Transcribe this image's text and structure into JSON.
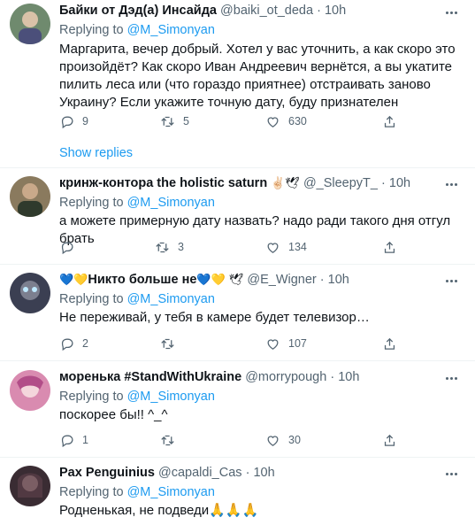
{
  "show_replies": "Show replies",
  "tweets": [
    {
      "name": "Байки от Дэд(а) Инсайда",
      "handle": "@baiki_ot_deda",
      "time": "10h",
      "replying_label": "Replying to",
      "replying_to": "@M_Simonyan",
      "text": "Маргарита, вечер добрый. Хотел у вас уточнить, а как скоро это произойдёт? Как скоро Иван Андреевич вернётся, а вы укатите пилить леса или (что гораздо приятнее) отстраивать заново Украину? Если укажите точную дату, буду признателен",
      "replies": "9",
      "retweets": "5",
      "likes": "630"
    },
    {
      "name": "кринж-контора the holistic saturn",
      "emoji": "✌🏻🕊",
      "handle": "@_SleepyT_",
      "time": "10h",
      "replying_label": "Replying to",
      "replying_to": "@M_Simonyan",
      "text": "а можете примерную дату назвать? надо ради такого дня отгул брать",
      "replies": "",
      "retweets": "3",
      "likes": "134"
    },
    {
      "name_prefix": "💙💛",
      "name": "Никто больше не",
      "name_suffix": "💙💛",
      "emoji": "🕊",
      "handle": "@E_Wigner",
      "time": "10h",
      "replying_label": "Replying to",
      "replying_to": "@M_Simonyan",
      "text": "Не переживай, у тебя в камере будет телевизор…",
      "replies": "2",
      "retweets": "",
      "likes": "107"
    },
    {
      "name": "моренька #StandWithUkraine",
      "handle": "@morrypough",
      "time": "10h",
      "replying_label": "Replying to",
      "replying_to": "@M_Simonyan",
      "text": "поскорее бы!! ^_^",
      "replies": "1",
      "retweets": "",
      "likes": "30"
    },
    {
      "name": "Pax Penguinius",
      "handle": "@capaldi_Cas",
      "time": "10h",
      "replying_label": "Replying to",
      "replying_to": "@M_Simonyan",
      "text": "Родненькая, не подведи🙏🙏🙏"
    }
  ],
  "colors": {
    "link": "#1d9bf0",
    "secondary_text": "#536471",
    "divider": "#eff3f4"
  }
}
